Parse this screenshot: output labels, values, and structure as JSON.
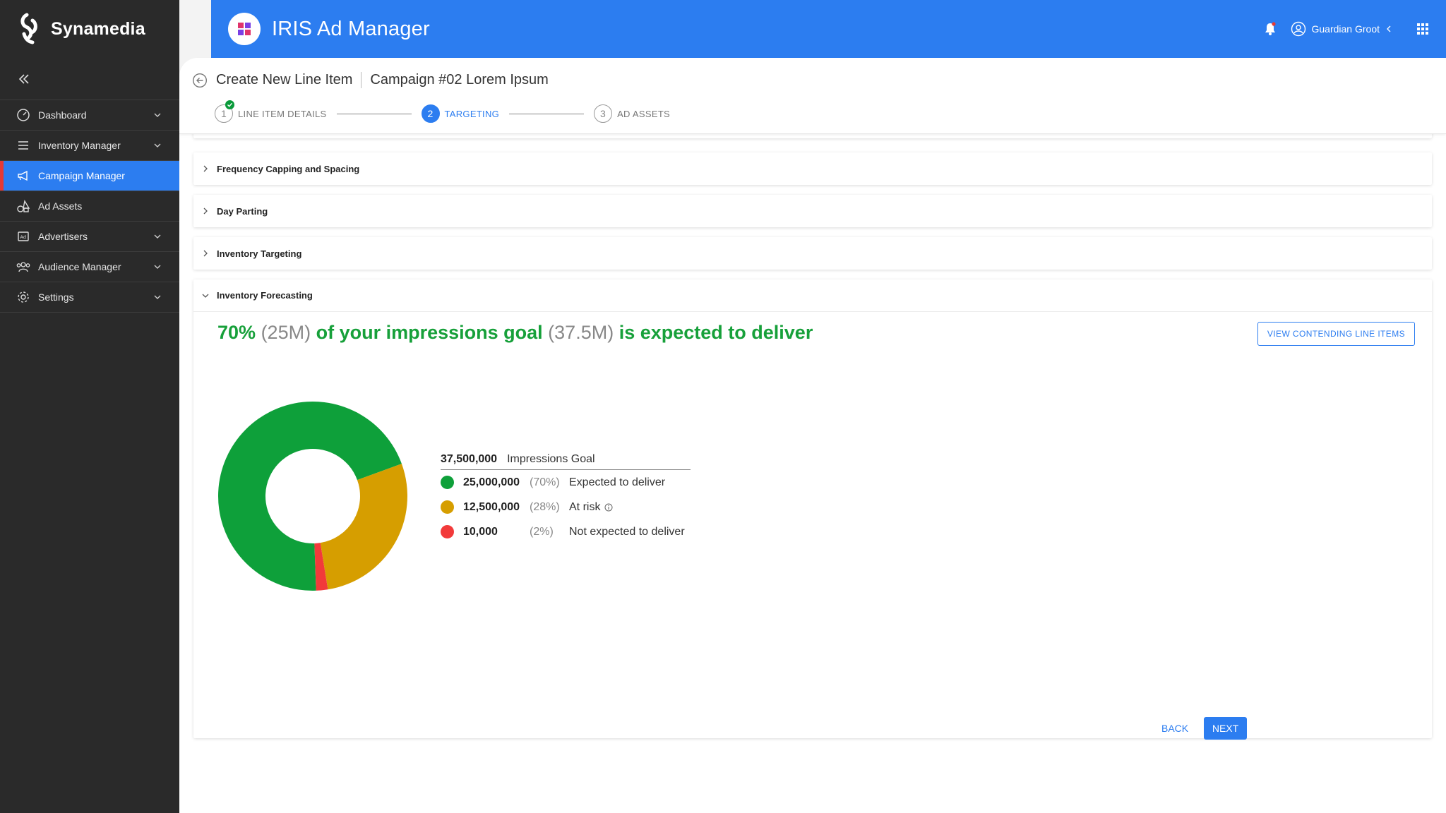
{
  "brand": {
    "name": "Synamedia"
  },
  "header": {
    "app_title": "IRIS Ad Manager",
    "user_name": "Guardian Groot",
    "accent": "#2c7df0"
  },
  "sidebar": {
    "items": [
      {
        "label": "Dashboard",
        "icon": "gauge-icon",
        "expandable": true
      },
      {
        "label": "Inventory Manager",
        "icon": "list-icon",
        "expandable": true
      },
      {
        "label": "Campaign Manager",
        "icon": "megaphone-icon",
        "expandable": false,
        "active": true
      },
      {
        "label": "Ad Assets",
        "icon": "shapes-icon",
        "expandable": false
      },
      {
        "label": "Advertisers",
        "icon": "ad-icon",
        "expandable": true
      },
      {
        "label": "Audience Manager",
        "icon": "people-icon",
        "expandable": true
      },
      {
        "label": "Settings",
        "icon": "gear-icon",
        "expandable": true
      }
    ]
  },
  "page": {
    "title": "Create New Line Item",
    "campaign": "Campaign #02 Lorem Ipsum",
    "steps": [
      {
        "num": "1",
        "label": "LINE ITEM DETAILS",
        "status": "complete"
      },
      {
        "num": "2",
        "label": "TARGETING",
        "status": "active"
      },
      {
        "num": "3",
        "label": "AD ASSETS",
        "status": "pending"
      }
    ]
  },
  "sections": [
    {
      "label": "Frequency Capping and Spacing",
      "expanded": false
    },
    {
      "label": "Day Parting",
      "expanded": false
    },
    {
      "label": "Inventory Targeting",
      "expanded": false
    },
    {
      "label": "Inventory Forecasting",
      "expanded": true
    }
  ],
  "forecast": {
    "pct": "70%",
    "amount": "(25M)",
    "text_mid": "of your impressions goal",
    "goal_short": "(37.5M)",
    "text_end": "is expected to deliver",
    "view_button": "VIEW CONTENDING LINE ITEMS",
    "goal_value": "37,500,000",
    "goal_label": "Impressions Goal",
    "legend": [
      {
        "value": "25,000,000",
        "pct": "(70%)",
        "label": "Expected to deliver",
        "color": "#0ea03a"
      },
      {
        "value": "12,500,000",
        "pct": "(28%)",
        "label": "At risk",
        "color": "#d69e00"
      },
      {
        "value": "10,000",
        "pct": "(2%)",
        "label": "Not expected to deliver",
        "color": "#f23a3a"
      }
    ]
  },
  "chart_data": {
    "type": "pie",
    "donut": true,
    "categories": [
      "Expected to deliver",
      "At risk",
      "Not expected to deliver"
    ],
    "values": [
      70,
      28,
      2
    ],
    "colors": [
      "#0ea03a",
      "#d69e00",
      "#f23a3a"
    ]
  },
  "footer": {
    "back": "BACK",
    "next": "NEXT"
  }
}
